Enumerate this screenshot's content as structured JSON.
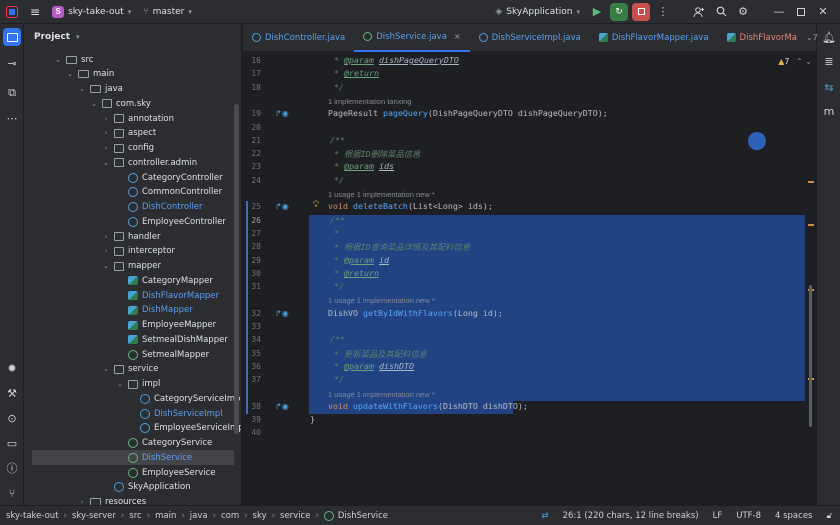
{
  "titlebar": {
    "project_badge": "S",
    "project_name": "sky-take-out",
    "branch": "master",
    "run_config": "SkyApplication"
  },
  "project_panel": {
    "title": "Project",
    "tree": [
      {
        "label": "src",
        "type": "folder",
        "expanded": true
      },
      {
        "label": "main",
        "type": "folder",
        "expanded": true
      },
      {
        "label": "java",
        "type": "folder",
        "expanded": true
      },
      {
        "label": "com.sky",
        "type": "package",
        "expanded": true
      },
      {
        "label": "annotation",
        "type": "package",
        "expanded": false
      },
      {
        "label": "aspect",
        "type": "package",
        "expanded": false
      },
      {
        "label": "config",
        "type": "package",
        "expanded": false
      },
      {
        "label": "controller.admin",
        "type": "package",
        "expanded": true
      },
      {
        "label": "CategoryController",
        "type": "class"
      },
      {
        "label": "CommonController",
        "type": "class"
      },
      {
        "label": "DishController",
        "type": "class",
        "modified": true
      },
      {
        "label": "EmployeeController",
        "type": "class"
      },
      {
        "label": "handler",
        "type": "package",
        "expanded": false
      },
      {
        "label": "interceptor",
        "type": "package",
        "expanded": false
      },
      {
        "label": "mapper",
        "type": "package",
        "expanded": true
      },
      {
        "label": "CategoryMapper",
        "type": "mapper"
      },
      {
        "label": "DishFlavorMapper",
        "type": "mapper",
        "modified": true
      },
      {
        "label": "DishMapper",
        "type": "mapper",
        "modified": true
      },
      {
        "label": "EmployeeMapper",
        "type": "mapper"
      },
      {
        "label": "SetmealDishMapper",
        "type": "mapper"
      },
      {
        "label": "SetmealMapper",
        "type": "interface"
      },
      {
        "label": "service",
        "type": "package",
        "expanded": true
      },
      {
        "label": "impl",
        "type": "package",
        "expanded": true
      },
      {
        "label": "CategoryServiceImpl",
        "type": "class"
      },
      {
        "label": "DishServiceImpl",
        "type": "class",
        "modified": true
      },
      {
        "label": "EmployeeServiceImpl",
        "type": "class"
      },
      {
        "label": "CategoryService",
        "type": "interface"
      },
      {
        "label": "DishService",
        "type": "interface",
        "modified": true,
        "selected": true
      },
      {
        "label": "EmployeeService",
        "type": "interface"
      },
      {
        "label": "SkyApplication",
        "type": "app"
      },
      {
        "label": "resources",
        "type": "folder",
        "expanded": false
      }
    ]
  },
  "tabs": [
    {
      "label": "DishController.java",
      "icon": "class",
      "active": false
    },
    {
      "label": "DishService.java",
      "icon": "interface",
      "active": true,
      "close": "×"
    },
    {
      "label": "DishServiceImpl.java",
      "icon": "class",
      "active": false
    },
    {
      "label": "DishFlavorMapper.java",
      "icon": "mapper",
      "active": false
    },
    {
      "label": "DishFlavorMa",
      "icon": "mapper",
      "active": false
    }
  ],
  "editor": {
    "warnings": "▲7",
    "lines": [
      {
        "n": "16",
        "text": "* @param dishPageQueryDTO"
      },
      {
        "n": "17",
        "text": "* @return"
      },
      {
        "n": "18",
        "text": "*/"
      },
      {
        "hint": "1 implementation    tanxing"
      },
      {
        "n": "19",
        "text": "PageResult pageQuery(DishPageQueryDTO dishPageQueryDTO);"
      },
      {
        "n": "20",
        "text": ""
      },
      {
        "n": "21",
        "text": "/**"
      },
      {
        "n": "22",
        "text": "* 根据ID删除菜品信息"
      },
      {
        "n": "23",
        "text": "* @param ids"
      },
      {
        "n": "24",
        "text": "*/"
      },
      {
        "hint": "1 usage    1 implementation    new *"
      },
      {
        "n": "25",
        "text": "void deleteBatch(List<Long> ids);"
      },
      {
        "n": "26",
        "text": "/**"
      },
      {
        "n": "27",
        "text": "*"
      },
      {
        "n": "28",
        "text": "* 根据ID查询菜品详情及其配料信息"
      },
      {
        "n": "29",
        "text": "* @param id"
      },
      {
        "n": "30",
        "text": "* @return"
      },
      {
        "n": "31",
        "text": "*/"
      },
      {
        "hint": "1 usage    1 implementation    new *"
      },
      {
        "n": "32",
        "text": "DishVO getByIdWithFlavors(Long id);"
      },
      {
        "n": "33",
        "text": ""
      },
      {
        "n": "34",
        "text": "/**"
      },
      {
        "n": "35",
        "text": "* 更新菜品及其配料信息"
      },
      {
        "n": "36",
        "text": "* @param dishDTO"
      },
      {
        "n": "37",
        "text": "*/"
      },
      {
        "hint": "1 usage    1 implementation    new *"
      },
      {
        "n": "38",
        "text": "void updateWithFlavors(DishDTO dishDTO);"
      },
      {
        "n": "39",
        "text": "}"
      },
      {
        "n": "40",
        "text": ""
      }
    ]
  },
  "hints": {
    "h1a": "1 implementation",
    "h1b": "tanxing",
    "usage": "1 usage",
    "impl": "1 implementation",
    "new": "new *"
  },
  "status": {
    "breadcrumb": [
      "sky-take-out",
      "sky-server",
      "src",
      "main",
      "java",
      "com",
      "sky",
      "service",
      "DishService"
    ],
    "position": "26:1 (220 chars, 12 line breaks)",
    "line_ending": "LF",
    "encoding": "UTF-8",
    "indent": "4 spaces"
  }
}
